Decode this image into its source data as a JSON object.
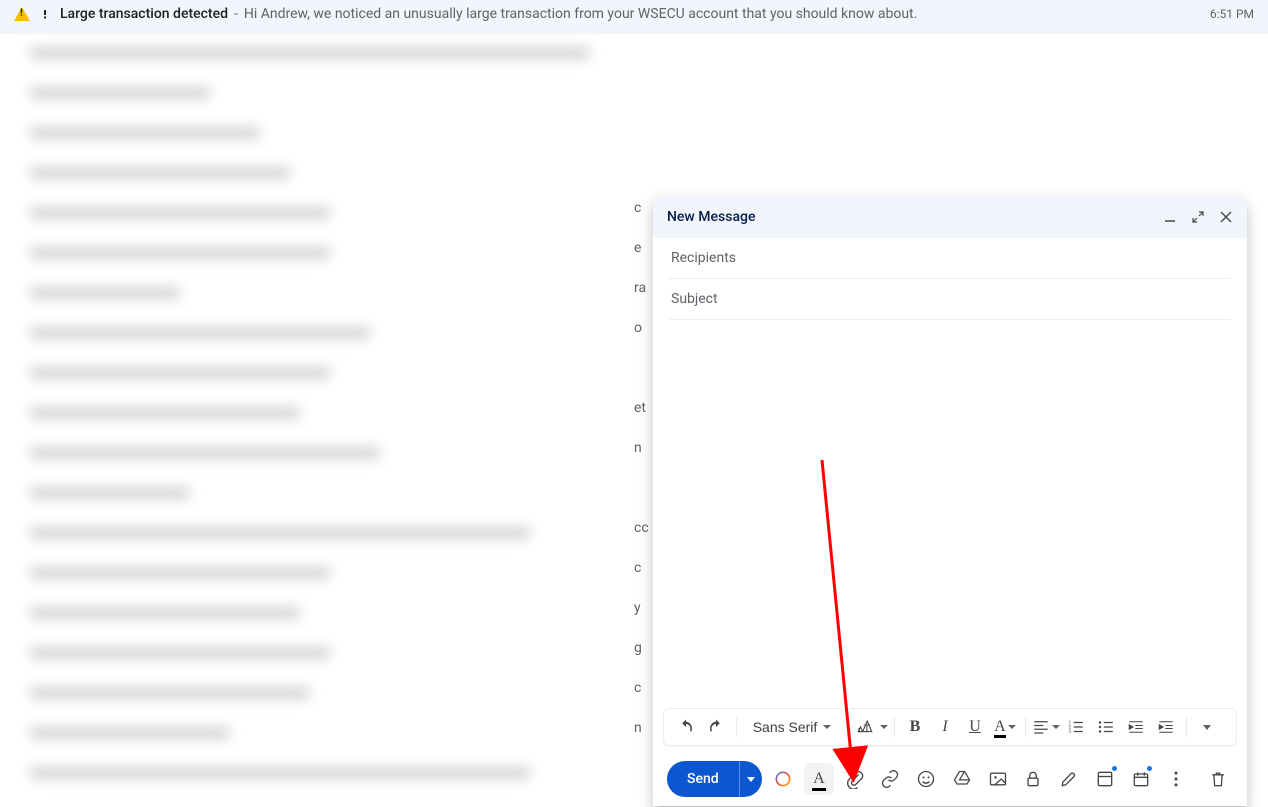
{
  "inbox": {
    "alert_row": {
      "subject": "Large transaction detected",
      "separator": " - ",
      "body": "Hi Andrew, we noticed an unusually large transaction from your WSECU account that you should know about.",
      "time": "6:51 PM"
    },
    "peeks": [
      "c",
      "e",
      "ra",
      "o",
      "et",
      "n",
      "cc",
      "c",
      "y",
      "g",
      "c",
      "n"
    ]
  },
  "compose": {
    "title": "New Message",
    "recipients_placeholder": "Recipients",
    "subject_placeholder": "Subject",
    "format": {
      "font": "Sans Serif"
    },
    "send_label": "Send"
  }
}
